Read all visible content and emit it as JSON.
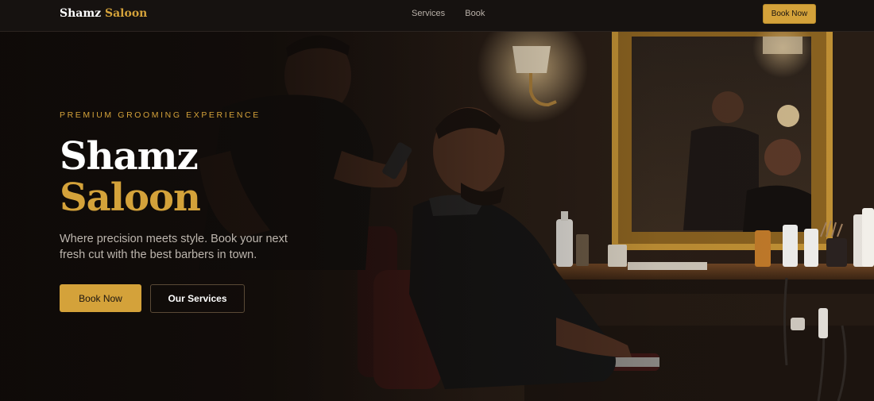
{
  "nav": {
    "brand_first": "Shamz",
    "brand_second": "Saloon",
    "links": [
      "Services",
      "Book"
    ],
    "cta_label": "Book Now"
  },
  "hero": {
    "eyebrow": "PREMIUM GROOMING EXPERIENCE",
    "title_line1": "Shamz",
    "title_line2": "Saloon",
    "tagline": "Where precision meets style. Book your next fresh cut with the best barbers in town.",
    "primary_label": "Book Now",
    "secondary_label": "Our Services"
  },
  "colors": {
    "accent": "#d4a23a",
    "background": "#120e0c",
    "text": "#ffffff",
    "muted_text": "#bdb6ae"
  }
}
